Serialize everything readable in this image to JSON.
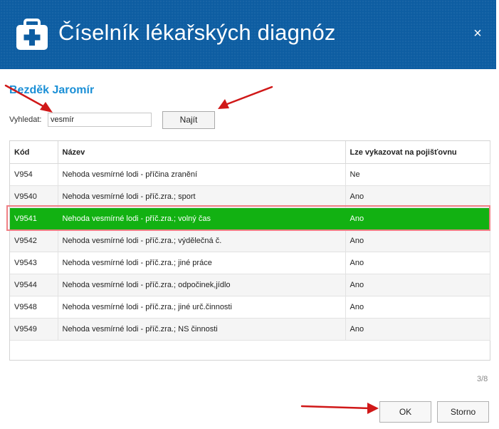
{
  "dialog": {
    "title": "Číselník lékařských diagnóz",
    "close_glyph": "×",
    "header_icon": "medical-cross-icon"
  },
  "patient": {
    "name": "Bezděk Jaromír"
  },
  "search": {
    "label": "Vyhledat:",
    "value": "vesmír",
    "button_label": "Najít"
  },
  "grid": {
    "columns": [
      "Kód",
      "Název",
      "Lze vykazovat na pojišťovnu"
    ],
    "rows": [
      {
        "code": "V954",
        "name": "Nehoda vesmírné lodi - příčina zranění",
        "billable": "Ne"
      },
      {
        "code": "V9540",
        "name": "Nehoda vesmírné lodi - příč.zra.; sport",
        "billable": "Ano"
      },
      {
        "code": "V9541",
        "name": "Nehoda vesmírné lodi - příč.zra.; volný čas",
        "billable": "Ano"
      },
      {
        "code": "V9542",
        "name": "Nehoda vesmírné lodi - příč.zra.; výdělečná č.",
        "billable": "Ano"
      },
      {
        "code": "V9543",
        "name": "Nehoda vesmírné lodi - příč.zra.; jiné práce",
        "billable": "Ano"
      },
      {
        "code": "V9544",
        "name": "Nehoda vesmírné lodi - příč.zra.; odpočinek,jídlo",
        "billable": "Ano"
      },
      {
        "code": "V9548",
        "name": "Nehoda vesmírné lodi - příč.zra.; jiné urč.činnosti",
        "billable": "Ano"
      },
      {
        "code": "V9549",
        "name": "Nehoda vesmírné lodi - příč.zra.; NS činnosti",
        "billable": "Ano"
      }
    ],
    "selected_code": "V9541",
    "selected_color": "#12b112"
  },
  "pager": {
    "text": "3/8"
  },
  "footer": {
    "ok_label": "OK",
    "cancel_label": "Storno"
  },
  "colors": {
    "header_bg": "#0d5da2",
    "accent": "#1a8fd6",
    "annotation_arrow": "#d01818",
    "selection_outline": "#ef7f85"
  }
}
